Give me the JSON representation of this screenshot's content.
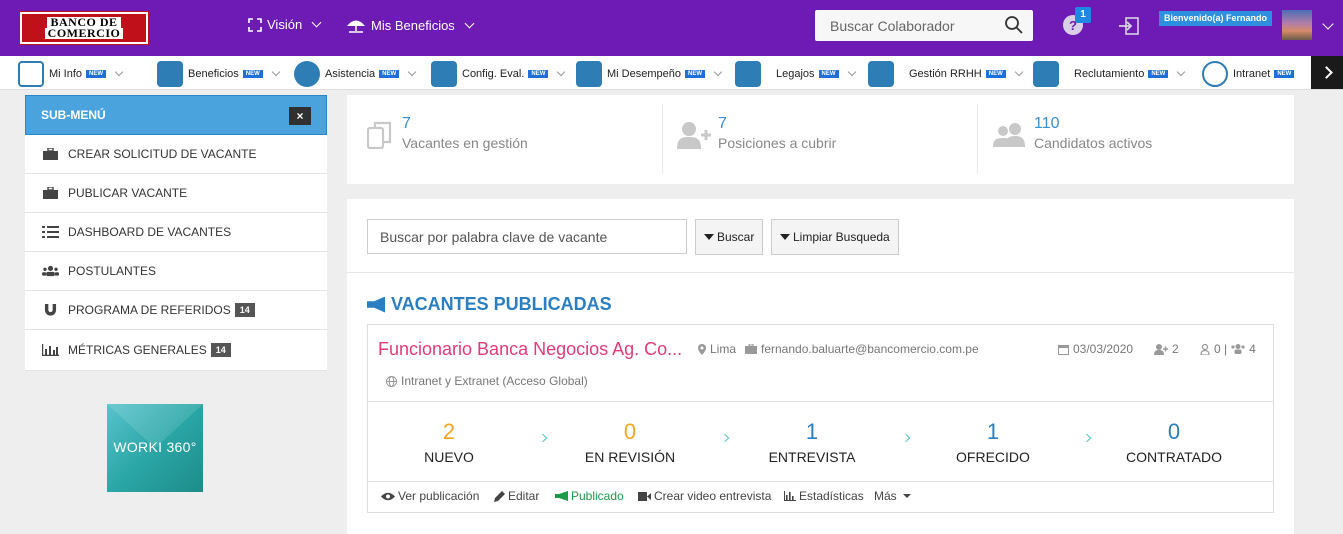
{
  "header": {
    "logo_line1": "BANCO DE",
    "logo_line2": "COMERCIO",
    "nav_vision": "Visión",
    "nav_beneficios": "Mis Beneficios",
    "search_placeholder": "Buscar Colaborador",
    "notification_count": "1",
    "welcome": "Bienvenido(a) Fernando"
  },
  "modules": [
    {
      "label": "Mi Info",
      "badge": "NEW"
    },
    {
      "label": "Beneficios",
      "badge": "NEW"
    },
    {
      "label": "Asistencia",
      "badge": "NEW"
    },
    {
      "label": "Config. Eval.",
      "badge": "NEW"
    },
    {
      "label": "Mi Desempeño",
      "badge": "NEW"
    },
    {
      "label": "Legajos",
      "badge": "NEW"
    },
    {
      "label": "Gestión RRHH",
      "badge": "NEW"
    },
    {
      "label": "Reclutamiento",
      "badge": "NEW"
    },
    {
      "label": "Intranet",
      "badge": "NEW"
    }
  ],
  "submenu": {
    "title": "SUB-MENÚ",
    "close": "×",
    "items": [
      {
        "label": "CREAR SOLICITUD DE VACANTE",
        "count": ""
      },
      {
        "label": "PUBLICAR VACANTE",
        "count": ""
      },
      {
        "label": "DASHBOARD DE VACANTES",
        "count": ""
      },
      {
        "label": "POSTULANTES",
        "count": ""
      },
      {
        "label": "PROGRAMA DE REFERIDOS",
        "count": "14"
      },
      {
        "label": "MÉTRICAS GENERALES",
        "count": "14"
      }
    ],
    "promo": "WORKI 360°"
  },
  "stats": [
    {
      "value": "7",
      "label": "Vacantes en gestión"
    },
    {
      "value": "7",
      "label": "Posiciones a cubrir"
    },
    {
      "value": "110",
      "label": "Candidatos activos"
    }
  ],
  "filters": {
    "keyword_placeholder": "Buscar por palabra clave de vacante",
    "search_button": "Buscar",
    "clear_button": "Limpiar Busqueda"
  },
  "section_title": "VACANTES PUBLICADAS",
  "vacancy": {
    "title": "Funcionario Banca Negocios Ag. Co...",
    "location": "Lima",
    "email": "fernando.baluarte@bancomercio.com.pe",
    "date": "03/03/2020",
    "positions": "2",
    "applicants": "0 | ",
    "team": "4",
    "scope": "Intranet y Extranet (Acceso Global)",
    "stages": [
      {
        "value": "2",
        "label": "NUEVO",
        "color": "#f5a623"
      },
      {
        "value": "0",
        "label": "EN REVISIÓN",
        "color": "#f5a623"
      },
      {
        "value": "1",
        "label": "ENTREVISTA",
        "color": "#2a7ec2"
      },
      {
        "value": "1",
        "label": "OFRECIDO",
        "color": "#2a7ec2"
      },
      {
        "value": "0",
        "label": "CONTRATADO",
        "color": "#2a7ec2"
      }
    ],
    "actions": {
      "ver": "Ver publicación",
      "editar": "Editar",
      "publicado": "Publicado",
      "video": "Crear video entrevista",
      "estadisticas": "Estadísticas",
      "mas": "Más"
    }
  },
  "colors": {
    "header": "#6e1bb6",
    "accent": "#2a7ec2",
    "vacancy_title": "#e13a7a",
    "published": "#1c9a4a"
  }
}
